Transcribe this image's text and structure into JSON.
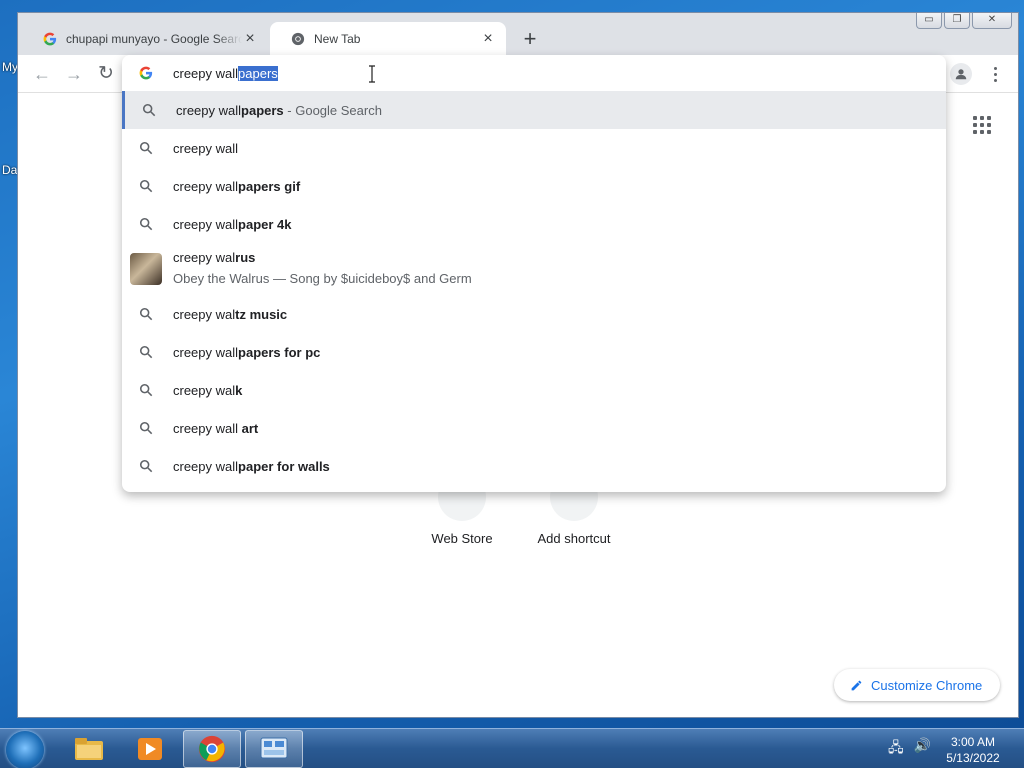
{
  "desktop": {
    "label_top": "My",
    "label_bottom": "Da"
  },
  "tabs": [
    {
      "title": "chupapi munyayo - Google Search",
      "close": "×"
    },
    {
      "title": "New Tab",
      "close": "×"
    }
  ],
  "new_tab_symbol": "+",
  "window_buttons": {
    "minimize": "▭",
    "maximize": "❐",
    "close": "✕"
  },
  "toolbar": {
    "back": "←",
    "forward": "→",
    "reload": "↻"
  },
  "omnibox": {
    "typed": "creepy wall",
    "autocomplete": "papers"
  },
  "suggestions": [
    {
      "plain": "creepy wall",
      "bold": "papers",
      "suffix": " - Google Search",
      "highlighted": true
    },
    {
      "plain": "creepy wall",
      "bold": ""
    },
    {
      "plain": "creepy wall",
      "bold": "papers gif"
    },
    {
      "plain": "creepy wall",
      "bold": "paper 4k"
    },
    {
      "plain": "creepy wal",
      "bold": "rus",
      "sub": "Obey the Walrus — Song by $uicideboy$ and Germ"
    },
    {
      "plain": "creepy wal",
      "bold": "tz music"
    },
    {
      "plain": "creepy wall",
      "bold": "papers for pc"
    },
    {
      "plain": "creepy wal",
      "bold": "k"
    },
    {
      "plain": "creepy wall",
      "bold": " art"
    },
    {
      "plain": "creepy wall",
      "bold": "paper for walls"
    }
  ],
  "shortcuts": [
    {
      "label": "Web Store"
    },
    {
      "label": "Add shortcut"
    }
  ],
  "customize_label": "Customize Chrome",
  "taskbar": {
    "items": [
      "file-explorer-icon",
      "media-player-icon",
      "chrome-icon",
      "control-panel-icon"
    ],
    "clock_time": "3:00 AM",
    "clock_date": "5/13/2022"
  },
  "colors": {
    "accent": "#1a73e8",
    "selection": "#3a6fcf"
  }
}
